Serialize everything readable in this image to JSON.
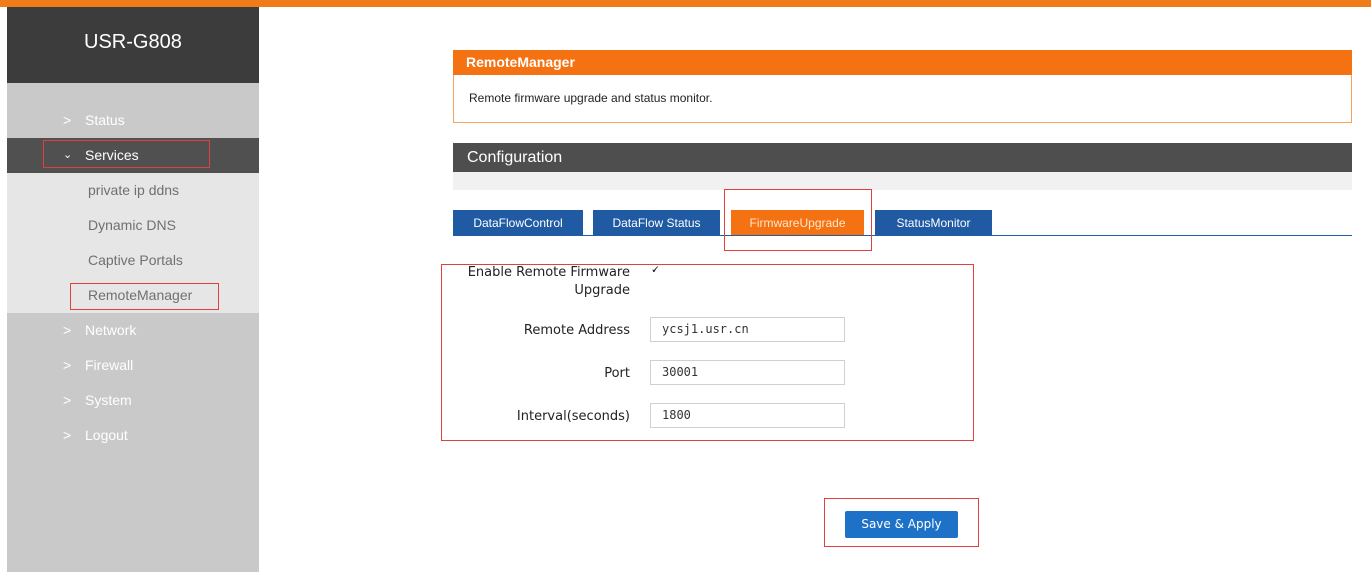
{
  "brand": "USR-G808",
  "sidebar": {
    "items": [
      {
        "chevron": ">",
        "label": "Status"
      },
      {
        "chevron": "⌄",
        "label": "Services"
      },
      {
        "chevron": ">",
        "label": "Network"
      },
      {
        "chevron": ">",
        "label": "Firewall"
      },
      {
        "chevron": ">",
        "label": "System"
      },
      {
        "chevron": ">",
        "label": "Logout"
      }
    ],
    "subitems": [
      "private ip ddns",
      "Dynamic DNS",
      "Captive Portals",
      "RemoteManager"
    ]
  },
  "remote_manager": {
    "title": "RemoteManager",
    "description": "Remote firmware upgrade and status monitor."
  },
  "configuration": {
    "title": "Configuration",
    "tabs": [
      "DataFlowControl",
      "DataFlow Status",
      "FirmwareUpgrade",
      "StatusMonitor"
    ],
    "active_tab": "FirmwareUpgrade"
  },
  "form": {
    "enable_label_line1": "Enable Remote Firmware",
    "enable_label_line2": "Upgrade",
    "enable_checked": true,
    "check_mark": "🗸",
    "remote_address_label": "Remote Address",
    "remote_address_value": "ycsj1.usr.cn",
    "port_label": "Port",
    "port_value": "30001",
    "interval_label": "Interval(seconds)",
    "interval_value": "1800"
  },
  "save_label": "Save & Apply",
  "colors": {
    "accent_orange": "#f57212",
    "tab_blue": "#1f5aa3",
    "button_blue": "#1d72c8",
    "annotation_red": "#e0413f"
  }
}
